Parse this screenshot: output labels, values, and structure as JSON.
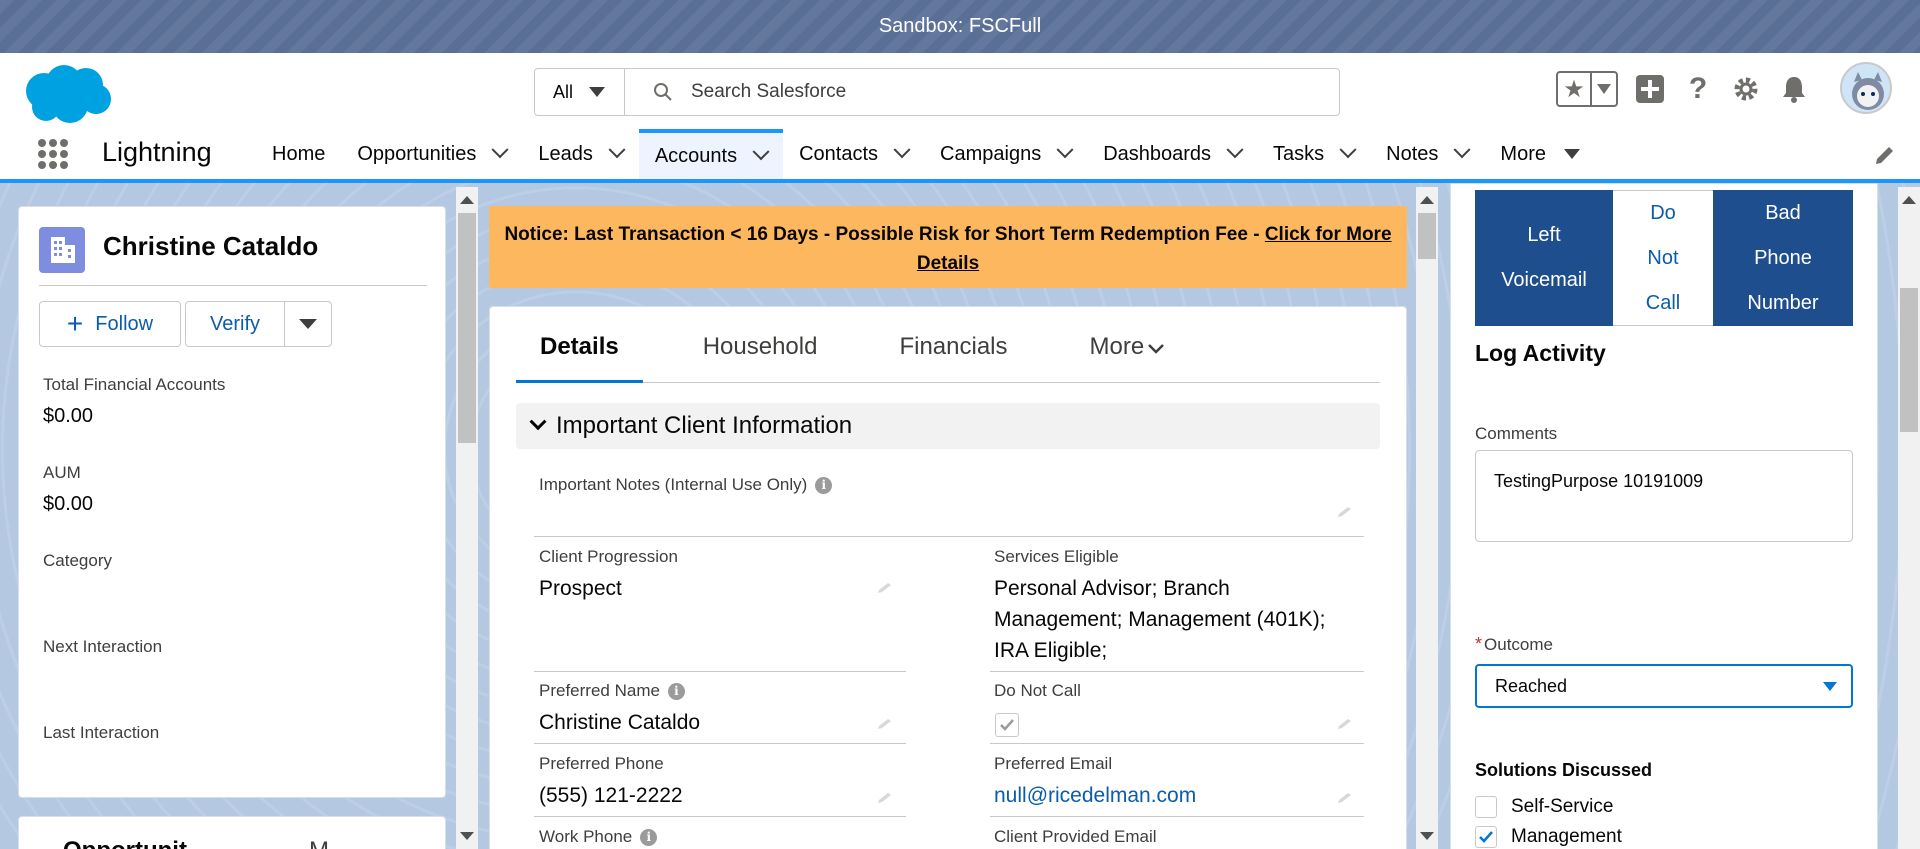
{
  "sandbox_banner": "Sandbox: FSCFull",
  "header": {
    "search_scope": "All",
    "search_placeholder": "Search Salesforce"
  },
  "nav": {
    "app_name": "Lightning",
    "items": [
      {
        "label": "Home",
        "has_menu": false
      },
      {
        "label": "Opportunities",
        "has_menu": true
      },
      {
        "label": "Leads",
        "has_menu": true
      },
      {
        "label": "Accounts",
        "has_menu": true,
        "active": true
      },
      {
        "label": "Contacts",
        "has_menu": true
      },
      {
        "label": "Campaigns",
        "has_menu": true
      },
      {
        "label": "Dashboards",
        "has_menu": true
      },
      {
        "label": "Tasks",
        "has_menu": true
      },
      {
        "label": "Notes",
        "has_menu": true
      }
    ],
    "more_label": "More"
  },
  "record": {
    "name": "Christine Cataldo",
    "follow_label": "Follow",
    "verify_label": "Verify",
    "highlights": [
      {
        "label": "Total Financial Accounts",
        "value": "$0.00"
      },
      {
        "label": "AUM",
        "value": "$0.00"
      },
      {
        "label": "Category",
        "value": ""
      },
      {
        "label": "Next Interaction",
        "value": ""
      },
      {
        "label": "Last Interaction",
        "value": ""
      }
    ],
    "next_card_title": "Opportunit",
    "next_card_more": "M"
  },
  "notice": {
    "text": "Notice: Last Transaction < 16 Days - Possible Risk for Short Term Redemption Fee - ",
    "link": "Click for More Details"
  },
  "detail": {
    "tabs": [
      "Details",
      "Household",
      "Financials",
      "More"
    ],
    "section_title": "Important Client Information",
    "fields": {
      "important_notes_label": "Important Notes (Internal Use Only)",
      "client_progression_label": "Client Progression",
      "client_progression_value": "Prospect",
      "services_eligible_label": "Services Eligible",
      "services_eligible_value": "Personal Advisor; Branch Management; Management (401K); IRA Eligible;",
      "preferred_name_label": "Preferred Name",
      "preferred_name_value": "Christine Cataldo",
      "do_not_call_label": "Do Not Call",
      "do_not_call_checked": true,
      "preferred_phone_label": "Preferred Phone",
      "preferred_phone_value": "(555) 121-2222",
      "preferred_email_label": "Preferred Email",
      "preferred_email_value": "null@ricedelman.com",
      "work_phone_label": "Work Phone",
      "client_provided_email_label": "Client Provided Email"
    }
  },
  "activity": {
    "buttons": [
      {
        "label": "Left Voicemail",
        "style": "dark"
      },
      {
        "label": "Do Not Call",
        "style": "light"
      },
      {
        "label": "Bad Phone Number",
        "style": "dark"
      }
    ],
    "log_title": "Log Activity",
    "comments_label": "Comments",
    "comments_value": "TestingPurpose 10191009",
    "outcome_label": "Outcome",
    "outcome_value": "Reached",
    "solutions_title": "Solutions Discussed",
    "solutions": [
      {
        "label": "Self-Service",
        "checked": false
      },
      {
        "label": "Management",
        "checked": true
      }
    ]
  },
  "colors": {
    "brand_blue": "#0176d3",
    "dark_button": "#1f4e8f",
    "notice_bg": "#fdb75e",
    "account_icon": "#7f8de1"
  }
}
